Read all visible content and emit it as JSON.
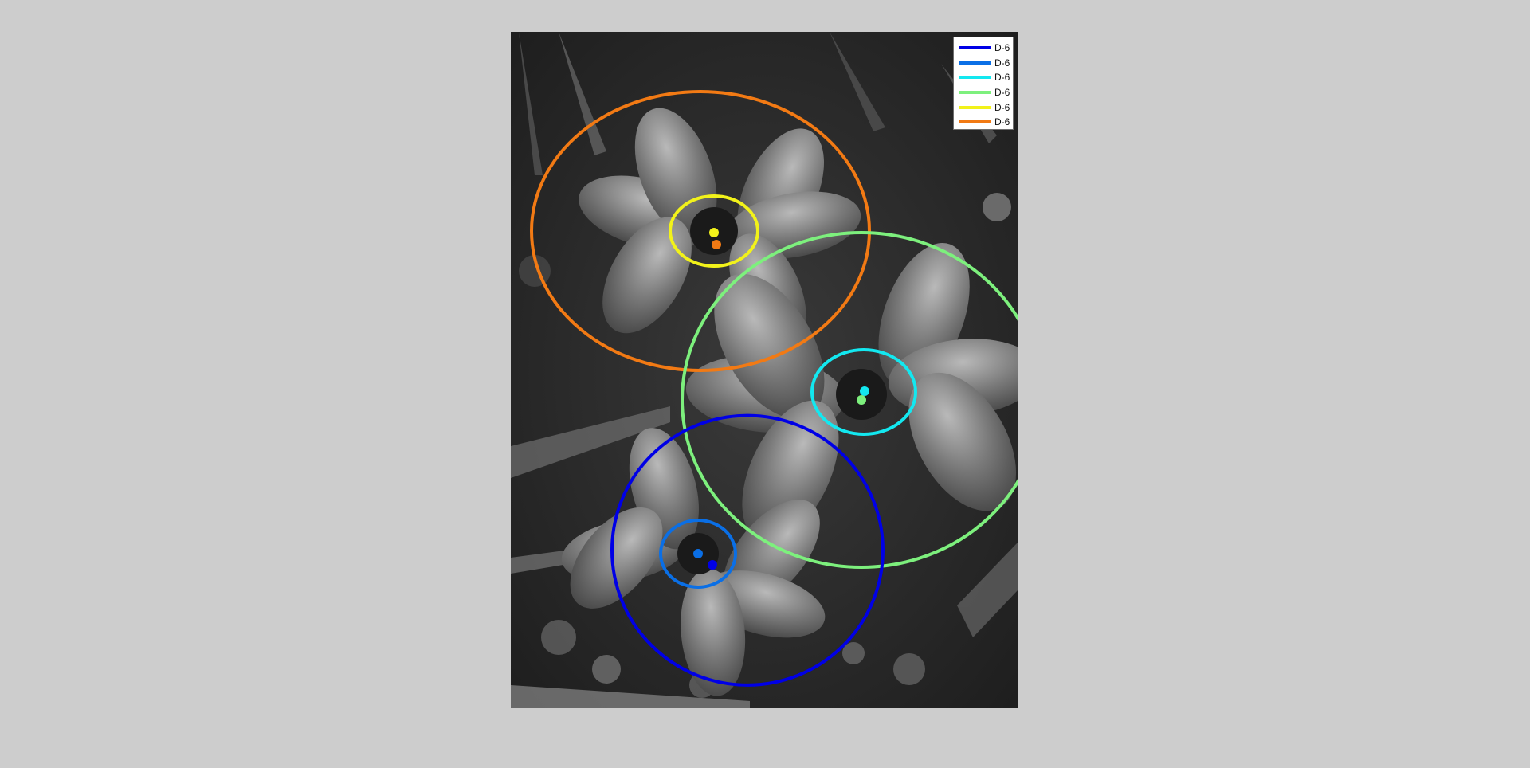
{
  "figure": {
    "background_color": "#cdcdcd",
    "image_description_icon": "grayscale-flower-photo"
  },
  "legend": {
    "entries": [
      {
        "label": "D-6",
        "color": "#0000e6"
      },
      {
        "label": "D-6",
        "color": "#0a6fe6"
      },
      {
        "label": "D-6",
        "color": "#13e8f0"
      },
      {
        "label": "D-6",
        "color": "#7df07d"
      },
      {
        "label": "D-6",
        "color": "#f2f21a"
      },
      {
        "label": "D-6",
        "color": "#f27a14"
      }
    ]
  }
}
